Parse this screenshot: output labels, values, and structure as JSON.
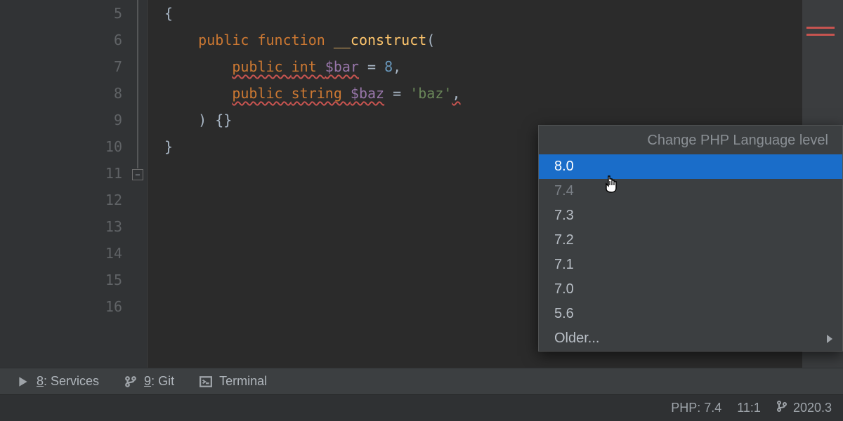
{
  "gutter": {
    "lines": [
      "5",
      "6",
      "7",
      "8",
      "9",
      "10",
      "11",
      "12",
      "13",
      "14",
      "15",
      "16"
    ]
  },
  "code": {
    "l5": "{",
    "l6_kw": "public function ",
    "l6_fn": "__construct",
    "l6_open": "(",
    "l7_kw": "public ",
    "l7_type": "int ",
    "l7_var": "$bar",
    "l7_rest": " = ",
    "l7_num": "8",
    "l7_comma": ",",
    "l8_kw": "public ",
    "l8_type": "string ",
    "l8_var": "$baz",
    "l8_rest": " = ",
    "l8_str": "'baz'",
    "l8_comma": ",",
    "l9": ") {}",
    "l10": "}"
  },
  "popup": {
    "title": "Change PHP Language level",
    "items": [
      {
        "label": "8.0",
        "selected": true
      },
      {
        "label": "7.4",
        "dim": true
      },
      {
        "label": "7.3"
      },
      {
        "label": "7.2"
      },
      {
        "label": "7.1"
      },
      {
        "label": "7.0"
      },
      {
        "label": "5.6"
      },
      {
        "label": "Older...",
        "submenu": true
      }
    ]
  },
  "toolbar": {
    "services_key": "8",
    "services_label": ": Services",
    "git_key": "9",
    "git_label": ": Git",
    "terminal_label": "Terminal"
  },
  "status": {
    "php": "PHP: 7.4",
    "pos": "11:1",
    "version": "2020.3"
  }
}
